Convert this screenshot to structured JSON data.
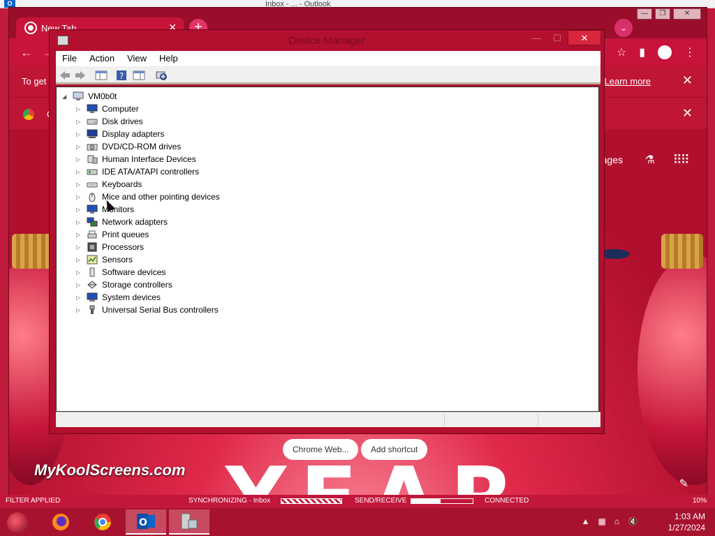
{
  "outlook": {
    "title": "Inbox - ... - Outlook",
    "status": {
      "filter": "FILTER APPLIED",
      "sync": "SYNCHRONIZING · Inbox",
      "send_receive": "SEND/RECEIVE",
      "connected": "CONNECTED",
      "zoom": "10%"
    }
  },
  "chrome": {
    "tab_title": "New Tab",
    "infobar_text": "To get",
    "infobar_link": "Learn more",
    "infobar2_text": "C",
    "images_link": "ages",
    "shortcuts": [
      "Chrome Web...",
      "Add shortcut"
    ],
    "watermark": "MyKoolScreens.com",
    "big_text": "YEAR"
  },
  "devmgr": {
    "title": "Device Manager",
    "close_glyph": "✕",
    "menu": [
      "File",
      "Action",
      "View",
      "Help"
    ],
    "root": "VM0b0t",
    "items": [
      {
        "label": "Computer",
        "icon": "monitor-icon"
      },
      {
        "label": "Disk drives",
        "icon": "disk-icon"
      },
      {
        "label": "Display adapters",
        "icon": "display-icon"
      },
      {
        "label": "DVD/CD-ROM drives",
        "icon": "dvd-icon"
      },
      {
        "label": "Human Interface Devices",
        "icon": "hid-icon"
      },
      {
        "label": "IDE ATA/ATAPI controllers",
        "icon": "ide-icon"
      },
      {
        "label": "Keyboards",
        "icon": "keyboard-icon"
      },
      {
        "label": "Mice and other pointing devices",
        "icon": "mouse-icon"
      },
      {
        "label": "Monitors",
        "icon": "monitor-icon"
      },
      {
        "label": "Network adapters",
        "icon": "network-icon"
      },
      {
        "label": "Print queues",
        "icon": "printer-icon"
      },
      {
        "label": "Processors",
        "icon": "cpu-icon"
      },
      {
        "label": "Sensors",
        "icon": "sensor-icon"
      },
      {
        "label": "Software devices",
        "icon": "software-icon"
      },
      {
        "label": "Storage controllers",
        "icon": "storage-icon"
      },
      {
        "label": "System devices",
        "icon": "system-icon"
      },
      {
        "label": "Universal Serial Bus controllers",
        "icon": "usb-icon"
      }
    ]
  },
  "taskbar": {
    "time": "1:03 AM",
    "date": "1/27/2024",
    "apps": [
      "firefox-icon",
      "chrome-icon",
      "outlook-icon",
      "device-manager-icon"
    ]
  },
  "colors": {
    "accent": "#c8143a",
    "window_frame": "#b30f2e",
    "close_button": "#d7263d"
  }
}
